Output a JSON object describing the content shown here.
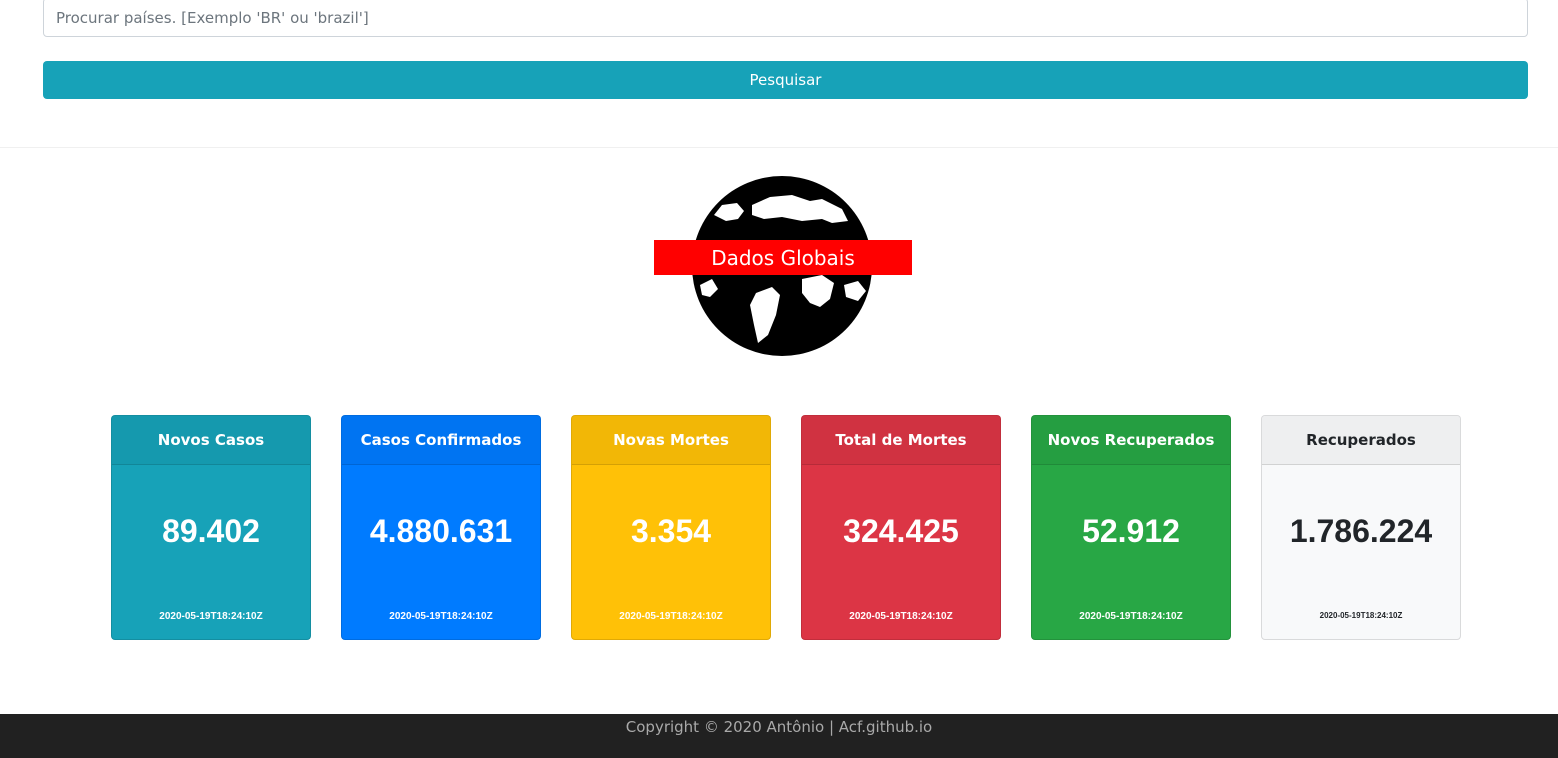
{
  "search": {
    "placeholder": "Procurar países. [Exemplo 'BR' ou 'brazil']",
    "button_label": "Pesquisar"
  },
  "logo": {
    "title": "Dados Globais",
    "banner_color": "#ff0000"
  },
  "cards": [
    {
      "title": "Novos Casos",
      "value": "89.402",
      "date": "2020-05-19T18:24:10Z",
      "color": "#17a2b8",
      "text_color": "#ffffff"
    },
    {
      "title": "Casos Confirmados",
      "value": "4.880.631",
      "date": "2020-05-19T18:24:10Z",
      "color": "#007bff",
      "text_color": "#ffffff"
    },
    {
      "title": "Novas Mortes",
      "value": "3.354",
      "date": "2020-05-19T18:24:10Z",
      "color": "#ffc107",
      "text_color": "#ffffff"
    },
    {
      "title": "Total de Mortes",
      "value": "324.425",
      "date": "2020-05-19T18:24:10Z",
      "color": "#dc3545",
      "text_color": "#ffffff"
    },
    {
      "title": "Novos Recuperados",
      "value": "52.912",
      "date": "2020-05-19T18:24:10Z",
      "color": "#28a745",
      "text_color": "#ffffff"
    },
    {
      "title": "Recuperados",
      "value": "1.786.224",
      "date": "2020-05-19T18:24:10Z",
      "color": "#f8f9fa",
      "text_color": "#212529"
    }
  ],
  "footer": {
    "text": "Copyright © 2020 Antônio | Acf.github.io"
  }
}
